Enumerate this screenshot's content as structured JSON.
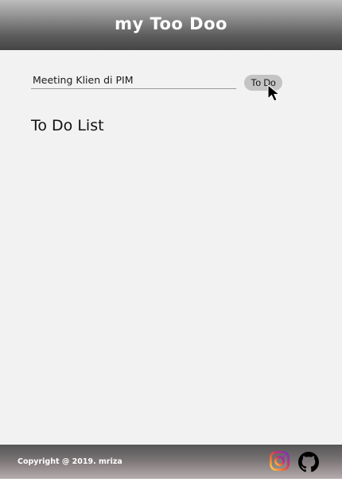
{
  "header": {
    "title": "my Too Doo"
  },
  "form": {
    "input_value": "Meeting Klien di PIM",
    "button_label": "To Do"
  },
  "list": {
    "title": "To Do List",
    "items": []
  },
  "footer": {
    "copyright": "Copyright @ 2019. mriza",
    "links": [
      {
        "icon": "instagram-icon"
      },
      {
        "icon": "github-icon"
      }
    ]
  },
  "colors": {
    "background": "#f2f2f2",
    "header_top": "#bdbdbd",
    "header_bottom": "#444444",
    "button": "#c4c4c4",
    "footer_top": "#555555",
    "footer_bottom": "#b6acad"
  }
}
